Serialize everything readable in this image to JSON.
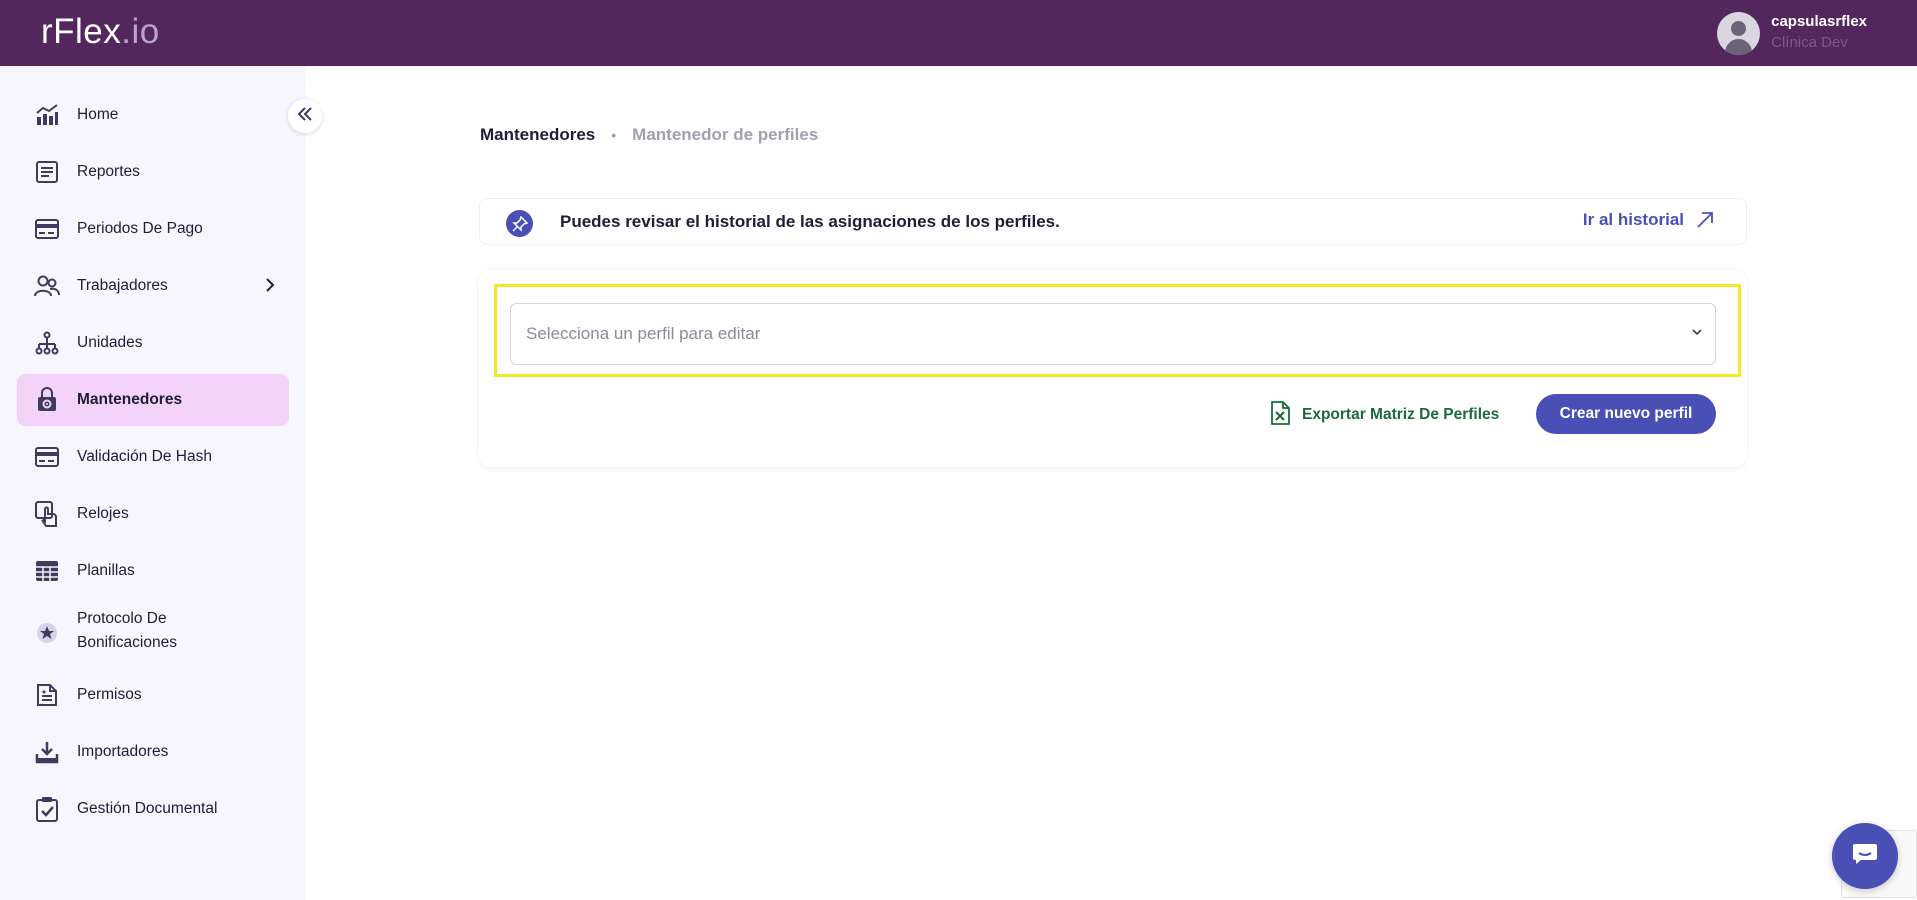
{
  "topbar": {
    "logo_main": "rFlex",
    "logo_suffix": ".io",
    "user_name": "capsulasrflex",
    "user_org": "Clínica Dev"
  },
  "sidebar": {
    "items": [
      {
        "label": "Home",
        "icon": "chart-growth-icon"
      },
      {
        "label": "Reportes",
        "icon": "report-icon"
      },
      {
        "label": "Periodos De Pago",
        "icon": "payment-card-icon"
      },
      {
        "label": "Trabajadores",
        "icon": "workers-icon"
      },
      {
        "label": "Unidades",
        "icon": "org-units-icon"
      },
      {
        "label": "Mantenedores",
        "icon": "lock-gear-icon"
      },
      {
        "label": "Validación De Hash",
        "icon": "hash-card-icon"
      },
      {
        "label": "Relojes",
        "icon": "touch-clock-icon"
      },
      {
        "label": "Planillas",
        "icon": "spreadsheet-icon"
      },
      {
        "label": "Protocolo De Bonificaciones",
        "label_line1": "Protocolo De",
        "label_line2": "Bonificaciones",
        "icon": "star-badge-icon"
      },
      {
        "label": "Permisos",
        "icon": "document-icon"
      },
      {
        "label": "Importadores",
        "icon": "import-icon"
      },
      {
        "label": "Gestión Documental",
        "icon": "clipboard-check-icon"
      }
    ],
    "active_item": "Mantenedores"
  },
  "breadcrumb": {
    "first": "Mantenedores",
    "separator": "•",
    "second": "Mantenedor de perfiles"
  },
  "info_bar": {
    "text": "Puedes revisar el historial de las asignaciones de los perfiles.",
    "link_label": "Ir al historial"
  },
  "profile_select": {
    "placeholder": "Selecciona un perfil para editar"
  },
  "actions": {
    "export_label": "Exportar Matriz De Perfiles",
    "create_label": "Crear nuevo perfil"
  },
  "colors": {
    "topbar": "#53275e",
    "sidebar_bg": "#f7f5fd",
    "active_item_bg": "#f3d4f8",
    "primary": "#4a4fb6",
    "export_green": "#1b6b3a",
    "highlight_yellow": "#f7e625"
  }
}
